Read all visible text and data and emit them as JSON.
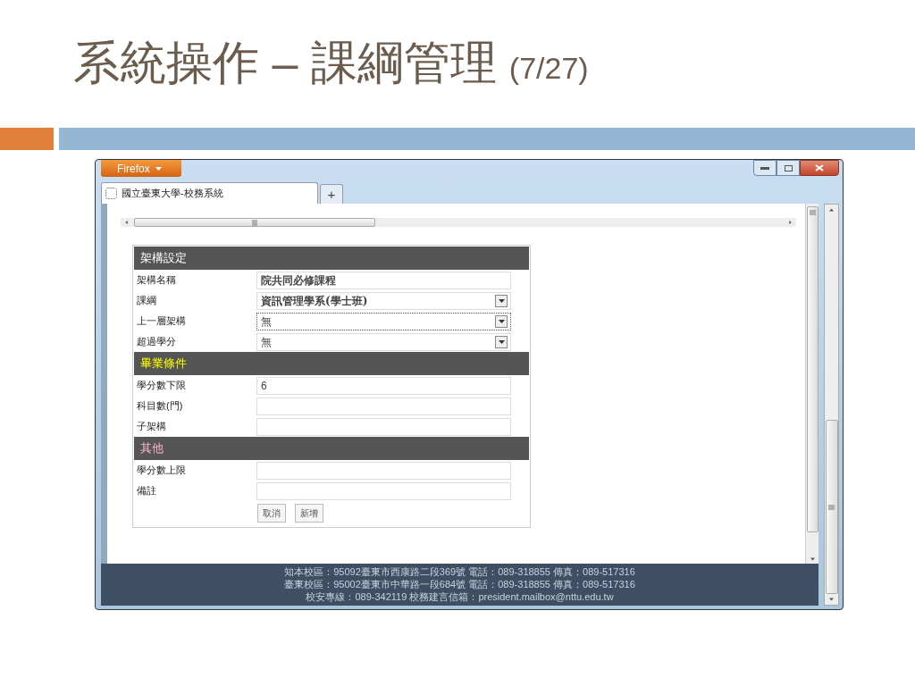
{
  "slide": {
    "title": "系統操作 – 課綱管理",
    "page": "(7/27)"
  },
  "browser": {
    "menu_button": "Firefox",
    "tab": {
      "title": "國立臺東大學-校務系統",
      "selected": true
    },
    "new_tab": "+",
    "form": {
      "sections": [
        {
          "title": "架構設定",
          "color": "#ffffff",
          "fields": [
            {
              "label": "架構名稱",
              "kind": "text",
              "value": "院共同必修課程",
              "bold": true
            },
            {
              "label": "課綱",
              "kind": "select",
              "value": "資訊管理學系(學士班)",
              "bold": true,
              "focused": false
            },
            {
              "label": "上一層架構",
              "kind": "select",
              "value": "無",
              "bold": false,
              "focused": true
            },
            {
              "label": "超過學分",
              "kind": "select",
              "value": "無",
              "bold": false,
              "focused": false
            }
          ]
        },
        {
          "title": "畢業條件",
          "color": "#ffff00",
          "fields": [
            {
              "label": "學分數下限",
              "kind": "text",
              "value": "6",
              "bold": false
            },
            {
              "label": "科目數(門)",
              "kind": "text"
            },
            {
              "label": "子架構",
              "kind": "text"
            }
          ]
        },
        {
          "title": "其他",
          "color": "#ffb6c8",
          "fields": [
            {
              "label": "學分數上限",
              "kind": "text"
            },
            {
              "label": "備註",
              "kind": "text"
            }
          ]
        }
      ],
      "buttons": [
        "取消",
        "新增"
      ]
    },
    "footer": [
      "知本校區：95092臺東市西康路二段369號 電話：089-318855 傳真：089-517316",
      "臺東校區：95002臺東市中華路一段684號 電話：089-318855 傳真：089-517316",
      "校安專線：089-342119 校務建言信箱：president.mailbox@nttu.edu.tw"
    ]
  }
}
